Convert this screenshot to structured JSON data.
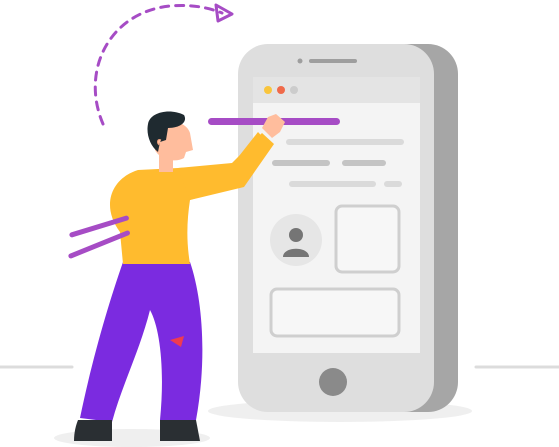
{
  "illustration": {
    "subject": "person-building-mobile-app",
    "colors": {
      "phone_outer": "#dedede",
      "phone_side": "#a6a6a6",
      "phone_bezel": "#c9c9c9",
      "screen": "#f4f4f4",
      "titlebar": "#e4e4e4",
      "placeholder_gray": "#c4c4c4",
      "accent_purple": "#a64cc5",
      "pants_purple": "#7b2be0",
      "shirt_yellow": "#ffbb2e",
      "skin": "#ffbd9d",
      "hair": "#1f2a30",
      "shoe": "#2a2f33",
      "dot_yellow": "#f9c53c",
      "dot_red": "#f06a4a",
      "dot_gray": "#cccccc",
      "floor_line": "#dcdcdc"
    },
    "icons": [
      "person-avatar-icon",
      "triangle-icon",
      "home-button-icon"
    ]
  }
}
